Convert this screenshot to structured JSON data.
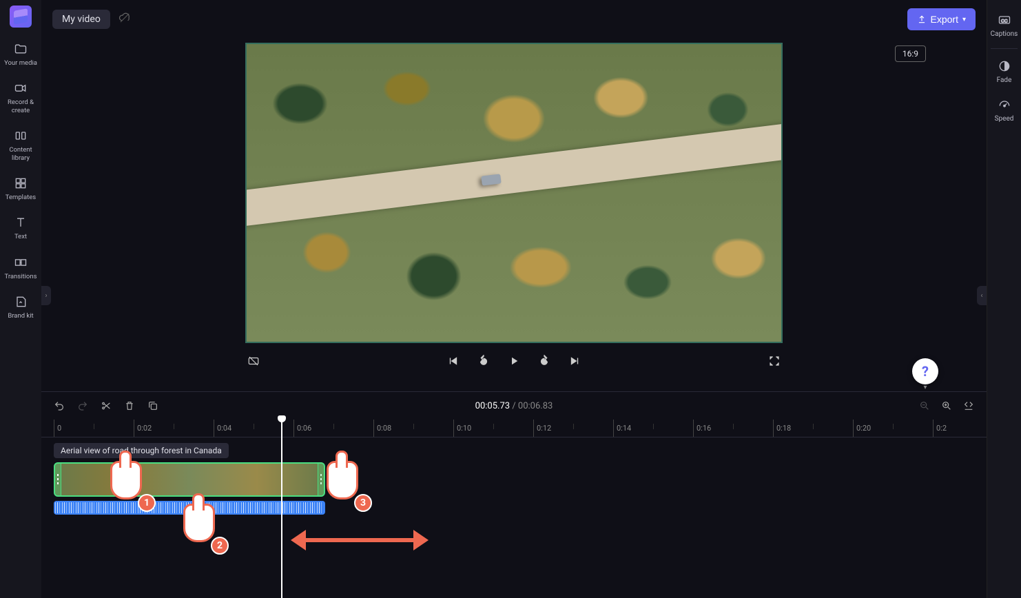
{
  "header": {
    "title": "My video",
    "export_label": "Export",
    "aspect_ratio": "16:9"
  },
  "sidebar_left": [
    {
      "key": "media",
      "label": "Your media"
    },
    {
      "key": "record",
      "label": "Record & create"
    },
    {
      "key": "library",
      "label": "Content library"
    },
    {
      "key": "templates",
      "label": "Templates"
    },
    {
      "key": "text",
      "label": "Text"
    },
    {
      "key": "transitions",
      "label": "Transitions"
    },
    {
      "key": "brand",
      "label": "Brand kit"
    }
  ],
  "sidebar_right": [
    {
      "key": "captions",
      "label": "Captions"
    },
    {
      "key": "fade",
      "label": "Fade"
    },
    {
      "key": "speed",
      "label": "Speed"
    }
  ],
  "playback": {
    "current": "00:05.73",
    "total": "00:06.83"
  },
  "ruler": {
    "marks": [
      "0",
      "0:02",
      "0:04",
      "0:06",
      "0:08",
      "0:10",
      "0:12",
      "0:14",
      "0:16",
      "0:18",
      "0:20",
      "0:2"
    ],
    "minor_per_major": 1
  },
  "clip": {
    "tooltip": "Aerial view of road through forest in Canada"
  },
  "annotations": {
    "hands": [
      "1",
      "2",
      "3"
    ]
  }
}
